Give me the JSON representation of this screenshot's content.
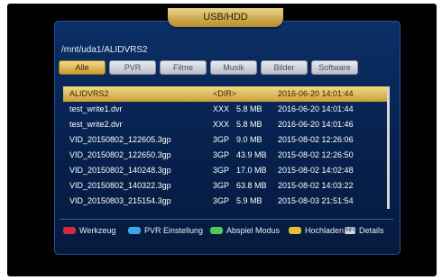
{
  "title": "USB/HDD",
  "path": "/mnt/uda1/ALIDVRS2",
  "tabs": [
    "Alle",
    "PVR",
    "Filme",
    "Musik",
    "Bilder",
    "Software"
  ],
  "active_tab": "Alle",
  "files": [
    {
      "name": "ALIDVRS2",
      "type": "<DIR>",
      "size": "",
      "date": "2016-06-20 14:01:44"
    },
    {
      "name": "test_write1.dvr",
      "type": "XXX",
      "size": "5.8 MB",
      "date": "2016-06-20 14:01:44"
    },
    {
      "name": "test_write2.dvr",
      "type": "XXX",
      "size": "5.8 MB",
      "date": "2016-06-20 14:01:46"
    },
    {
      "name": "VID_20150802_122605.3gp",
      "type": "3GP",
      "size": "9.0 MB",
      "date": "2015-08-02 12:26:06"
    },
    {
      "name": "VID_20150802_122650.3gp",
      "type": "3GP",
      "size": "43.9 MB",
      "date": "2015-08-02 12:26:50"
    },
    {
      "name": "VID_20150802_140248.3gp",
      "type": "3GP",
      "size": "17.0 MB",
      "date": "2015-08-02 14:02:48"
    },
    {
      "name": "VID_20150802_140322.3gp",
      "type": "3GP",
      "size": "63.8 MB",
      "date": "2015-08-02 14:03:22"
    },
    {
      "name": "VID_20150803_215154.3gp",
      "type": "3GP",
      "size": "5.9 MB",
      "date": "2015-08-03 21:51:54"
    }
  ],
  "footer": {
    "werkzeug": "Werkzeug",
    "pvr": "PVR Einstellung",
    "abspiel": "Abspiel Modus",
    "hochladen": "Hochladen",
    "info_key": "INFO",
    "details": "Details"
  },
  "colors": {
    "red_key": "#d22b3c",
    "blue_key": "#39a8e8",
    "green_key": "#54c75a",
    "yellow_key": "#e7bd34",
    "highlight": "#e6c55c",
    "panel": "#07214d"
  }
}
